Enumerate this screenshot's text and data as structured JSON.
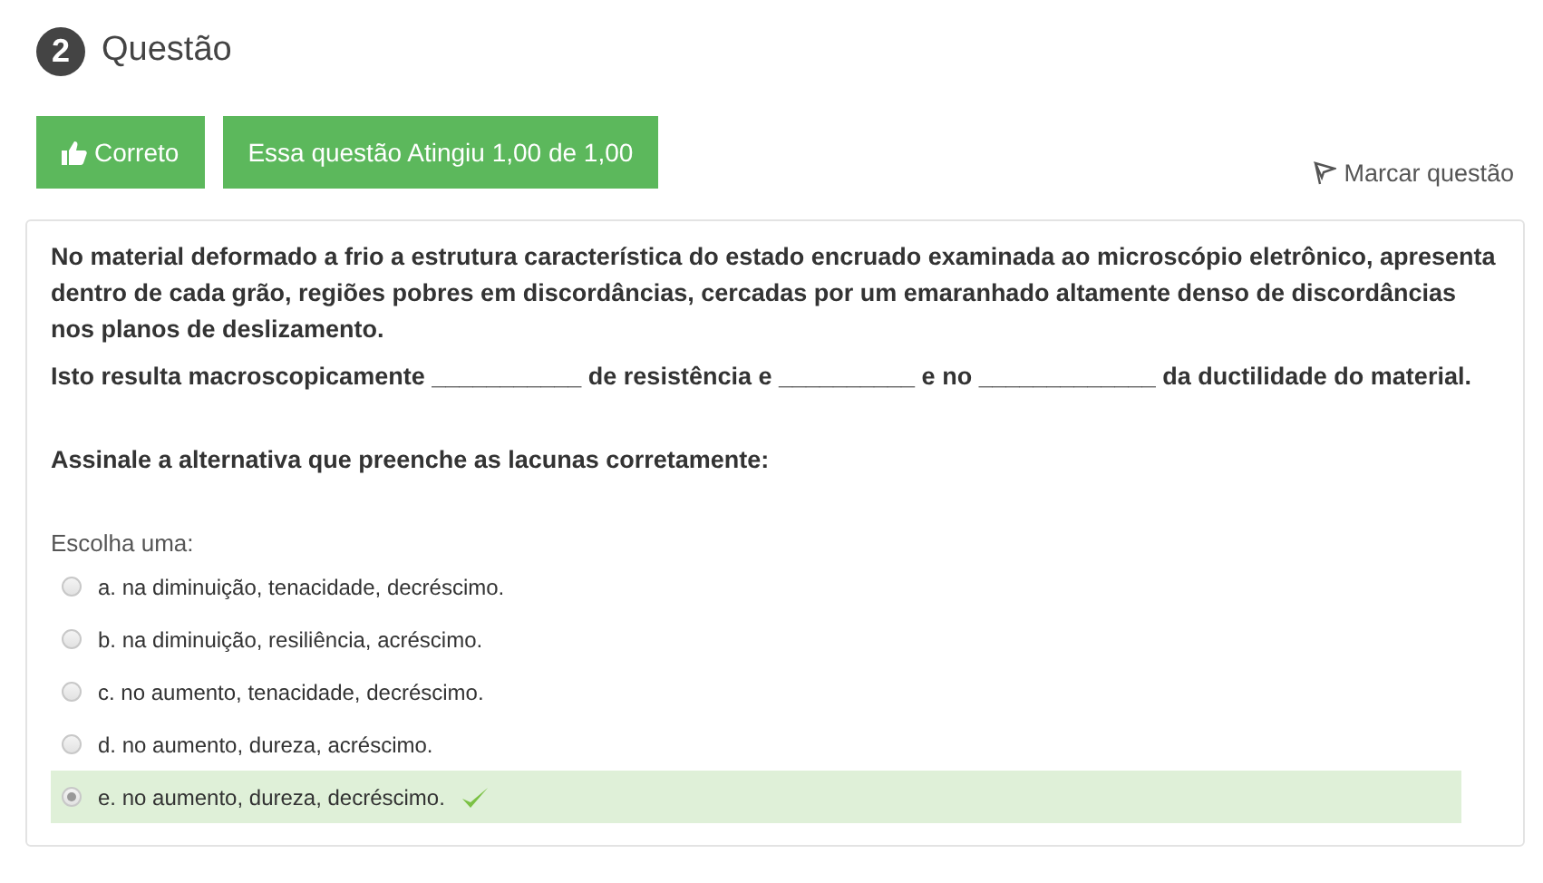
{
  "question": {
    "number": "2",
    "title": "Questão"
  },
  "status": {
    "result": "Correto",
    "grade": "Essa questão Atingiu 1,00 de 1,00",
    "flag": "Marcar questão",
    "correct": true
  },
  "prompt": {
    "paragraphs": [
      "No material deformado a frio a estrutura característica do estado encruado examinada ao microscópio eletrônico, apresenta dentro de cada grão, regiões pobres em discordâncias, cercadas por um emaranhado altamente denso de discordâncias nos planos de deslizamento.",
      "Isto resulta macroscopicamente ___________ de resistência e __________ e no _____________ da ductilidade do material.",
      "Assinale a alternativa que preenche as lacunas corretamente:"
    ]
  },
  "choice_label": "Escolha uma:",
  "options": [
    {
      "label": "a. na diminuição, tenacidade, decréscimo.",
      "selected": false,
      "correct": false
    },
    {
      "label": "b. na diminuição, resiliência, acréscimo.",
      "selected": false,
      "correct": false
    },
    {
      "label": "c. no aumento, tenacidade, decréscimo.",
      "selected": false,
      "correct": false
    },
    {
      "label": "d. no aumento, dureza, acréscimo.",
      "selected": false,
      "correct": false
    },
    {
      "label": "e. no aumento, dureza, decréscimo.",
      "selected": true,
      "correct": true
    }
  ]
}
